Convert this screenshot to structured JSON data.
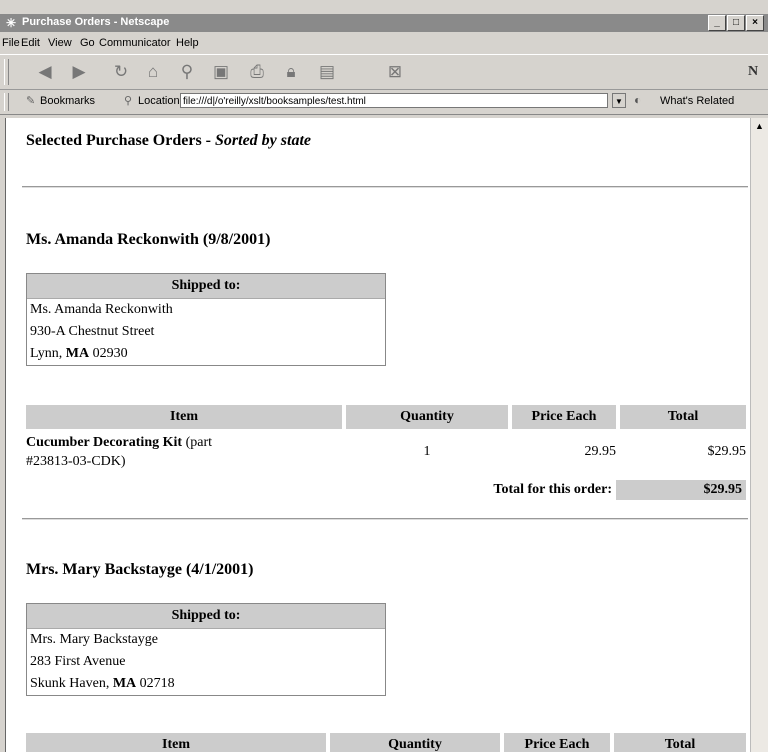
{
  "window": {
    "title": "Purchase Orders - Netscape",
    "controls": [
      "_",
      "□",
      "×"
    ]
  },
  "menu": [
    "File",
    "Edit",
    "View",
    "Go",
    "Communicator",
    "Help"
  ],
  "locationbar": {
    "bookmarks_label": "Bookmarks",
    "location_label": "Location:",
    "url": "file:///d|/o'reilly/xslt/booksamples/test.html",
    "related_label": "What's Related"
  },
  "page": {
    "heading": "Selected Purchase Orders - ",
    "heading_italic": "Sorted by state",
    "orders": [
      {
        "customer": "Ms. Amanda Reckonwith (9/8/2001)",
        "shipped_header": "Shipped to:",
        "address_lines": [
          "Ms. Amanda Reckonwith",
          "930-A Chestnut Street"
        ],
        "city": "Lynn, ",
        "state": "MA",
        "zip": " 02930",
        "columns": [
          "Item",
          "Quantity",
          "Price Each",
          "Total"
        ],
        "item_name": "Cucumber Decorating Kit",
        "item_part_1": " (part",
        "item_part_2": "#23813-03-CDK)",
        "quantity": "1",
        "price": "29.95",
        "total": "$29.95",
        "order_total_label": "Total for this order:",
        "order_total": "$29.95"
      },
      {
        "customer": "Mrs. Mary Backstayge (4/1/2001)",
        "shipped_header": "Shipped to:",
        "address_lines": [
          "Mrs. Mary Backstayge",
          "283 First Avenue"
        ],
        "city": "Skunk Haven, ",
        "state": "MA",
        "zip": " 02718",
        "columns": [
          "Item",
          "Quantity",
          "Price Each",
          "Total"
        ]
      }
    ]
  }
}
